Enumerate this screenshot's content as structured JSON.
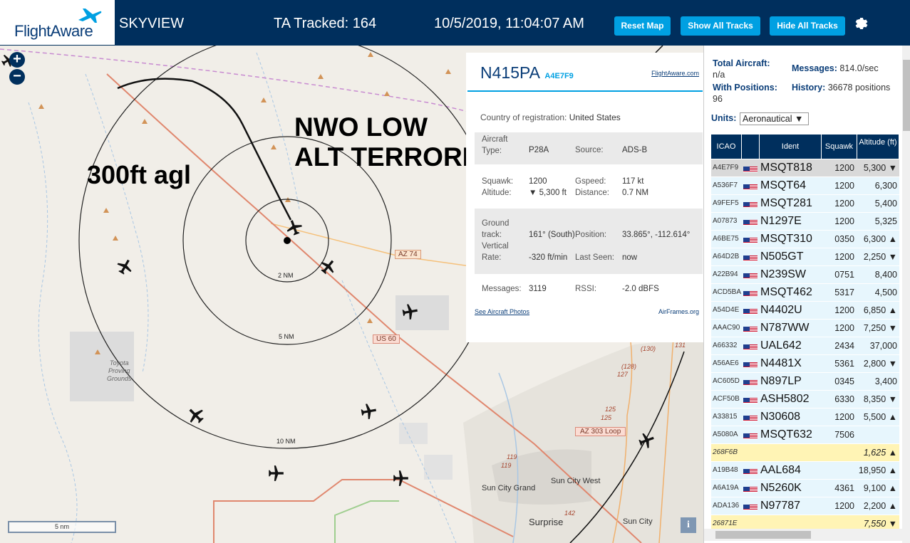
{
  "header": {
    "logo": "FlightAware",
    "app_name": "SKYVIEW",
    "tracked": "TA Tracked: 164",
    "clock": "10/5/2019, 11:04:07 AM",
    "btn_reset": "Reset Map",
    "btn_show": "Show All Tracks",
    "btn_hide": "Hide All Tracks",
    "gear_icon": "gear-icon"
  },
  "map": {
    "annotations": {
      "agl": "300ft agl",
      "nwo_line1": "NWO LOW",
      "nwo_line2": "ALT TERRORISM"
    },
    "ring_labels": [
      "2 NM",
      "5 NM",
      "10 NM"
    ],
    "road_labels": {
      "az74": "AZ 74",
      "us60": "US 60",
      "az303": "AZ 303 Loop",
      "r130": "(130)",
      "r128": "(128)",
      "r127": "127",
      "r125a": "125",
      "r125b": "125",
      "r119a": "119",
      "r119b": "119",
      "r142": "142",
      "r131": "131"
    },
    "place_labels": {
      "proving": "Toyota\nProving\nGrounds",
      "sun_city_grand": "Sun City Grand",
      "sun_city_west": "Sun City West",
      "surprise": "Surprise",
      "sun_city": "Sun City"
    },
    "scale": "5 nm",
    "zoom_in": "+",
    "zoom_out": "−",
    "info": "i"
  },
  "popup": {
    "callsign": "N415PA",
    "hex": "A4E7F9",
    "fa_link": "FlightAware.com",
    "country_label": "Country of registration:",
    "country": "United States",
    "aircraft_type_label": "Aircraft Type:",
    "aircraft_type": "P28A",
    "source_label": "Source:",
    "source": "ADS-B",
    "squawk_label": "Squawk:",
    "squawk": "1200",
    "gspeed_label": "Gspeed:",
    "gspeed": "117 kt",
    "altitude_label": "Altitude:",
    "altitude": "▼ 5,300 ft",
    "distance_label": "Distance:",
    "distance": "0.7 NM",
    "ground_track_label": "Ground track:",
    "ground_track": "161° (South)",
    "position_label": "Position:",
    "position": "33.865°, -112.614°",
    "vrate_label": "Vertical Rate:",
    "vrate": "-320 ft/min",
    "last_seen_label": "Last Seen:",
    "last_seen": "now",
    "messages_label": "Messages:",
    "messages": "3119",
    "rssi_label": "RSSI:",
    "rssi": "-2.0 dBFS",
    "photos_link": "See Aircraft Photos",
    "airframes_link": "AirFrames.org"
  },
  "panel": {
    "total_label": "Total Aircraft:",
    "total": "n/a",
    "messages_label": "Messages:",
    "messages": "814.0/sec",
    "positions_label": "With Positions:",
    "positions": "96",
    "history_label": "History:",
    "history": "36678 positions",
    "units_label": "Units:",
    "units_value": "Aeronautical ▼",
    "columns": {
      "icao": "ICAO",
      "ident": "Ident",
      "squawk": "Squawk",
      "altitude": "Altitude (ft)"
    },
    "rows": [
      {
        "icao": "A4E7F9",
        "flag": true,
        "ident": "MSQT818",
        "squawk": "1200",
        "alt": "5,300 ▼",
        "sel": true
      },
      {
        "icao": "A536F7",
        "flag": true,
        "ident": "MSQT64",
        "squawk": "1200",
        "alt": "6,300"
      },
      {
        "icao": "A9FEF5",
        "flag": true,
        "ident": "MSQT281",
        "squawk": "1200",
        "alt": "5,400"
      },
      {
        "icao": "A07873",
        "flag": true,
        "ident": "N1297E",
        "squawk": "1200",
        "alt": "5,325"
      },
      {
        "icao": "A6BE75",
        "flag": true,
        "ident": "MSQT310",
        "squawk": "0350",
        "alt": "6,300 ▲"
      },
      {
        "icao": "A64D2B",
        "flag": true,
        "ident": "N505GT",
        "squawk": "1200",
        "alt": "2,250 ▼"
      },
      {
        "icao": "A22B94",
        "flag": true,
        "ident": "N239SW",
        "squawk": "0751",
        "alt": "8,400"
      },
      {
        "icao": "ACD5BA",
        "flag": true,
        "ident": "MSQT462",
        "squawk": "5317",
        "alt": "4,500"
      },
      {
        "icao": "A54D4E",
        "flag": true,
        "ident": "N4402U",
        "squawk": "1200",
        "alt": "6,850 ▲"
      },
      {
        "icao": "AAAC90",
        "flag": true,
        "ident": "N787WW",
        "squawk": "1200",
        "alt": "7,250 ▼"
      },
      {
        "icao": "A66332",
        "flag": true,
        "ident": "UAL642",
        "squawk": "2434",
        "alt": "37,000"
      },
      {
        "icao": "A56AE6",
        "flag": true,
        "ident": "N4481X",
        "squawk": "5361",
        "alt": "2,800 ▼"
      },
      {
        "icao": "AC605D",
        "flag": true,
        "ident": "N897LP",
        "squawk": "0345",
        "alt": "3,400"
      },
      {
        "icao": "ACF50B",
        "flag": true,
        "ident": "ASH5802",
        "squawk": "6330",
        "alt": "8,350 ▼"
      },
      {
        "icao": "A33815",
        "flag": true,
        "ident": "N30608",
        "squawk": "1200",
        "alt": "5,500 ▲"
      },
      {
        "icao": "A5080A",
        "flag": true,
        "ident": "MSQT632",
        "squawk": "7506",
        "alt": ""
      },
      {
        "icao": "268F6B",
        "flag": false,
        "ident": "",
        "squawk": "",
        "alt": "1,625 ▲"
      },
      {
        "icao": "A19B48",
        "flag": true,
        "ident": "AAL684",
        "squawk": "",
        "alt": "18,950 ▲"
      },
      {
        "icao": "A6A19A",
        "flag": true,
        "ident": "N5260K",
        "squawk": "4361",
        "alt": "9,100 ▲"
      },
      {
        "icao": "ADA136",
        "flag": true,
        "ident": "N97787",
        "squawk": "1200",
        "alt": "2,200 ▲"
      },
      {
        "icao": "26871E",
        "flag": false,
        "ident": "",
        "squawk": "",
        "alt": "7,550 ▼"
      }
    ]
  }
}
